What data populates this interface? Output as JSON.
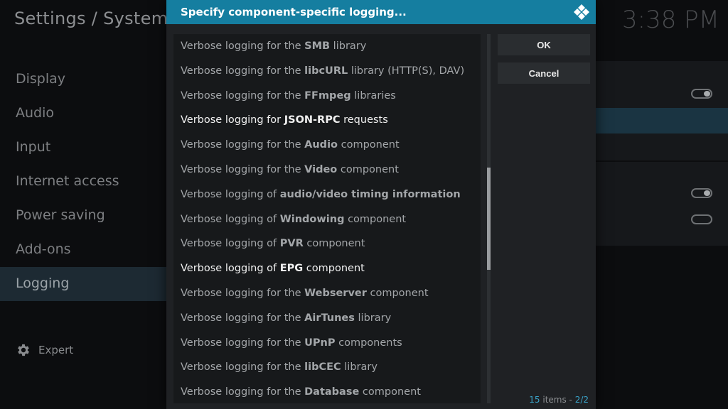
{
  "background": {
    "title": "Settings / System",
    "clock": "3:38 PM",
    "sidebar": [
      {
        "label": "Display"
      },
      {
        "label": "Audio"
      },
      {
        "label": "Input"
      },
      {
        "label": "Internet access"
      },
      {
        "label": "Power saving"
      },
      {
        "label": "Add-ons"
      },
      {
        "label": "Logging",
        "active": true
      }
    ],
    "expert_label": "Expert"
  },
  "dialog": {
    "title": "Specify component-specific logging...",
    "buttons": {
      "ok": "OK",
      "cancel": "Cancel"
    },
    "items": [
      {
        "pre": "Verbose logging for the ",
        "bold": "SMB",
        "post": " library"
      },
      {
        "pre": "Verbose logging for the ",
        "bold": "libcURL",
        "post": " library (HTTP(S), DAV)"
      },
      {
        "pre": "Verbose logging for the ",
        "bold": "FFmpeg",
        "post": " libraries"
      },
      {
        "pre": "Verbose logging for ",
        "bold": "JSON-RPC",
        "post": " requests",
        "selected": true
      },
      {
        "pre": "Verbose logging for the ",
        "bold": "Audio",
        "post": " component"
      },
      {
        "pre": "Verbose logging for the ",
        "bold": "Video",
        "post": " component"
      },
      {
        "pre": "Verbose logging of ",
        "bold": "audio/video timing information",
        "post": ""
      },
      {
        "pre": "Verbose logging of ",
        "bold": "Windowing",
        "post": " component"
      },
      {
        "pre": "Verbose logging of ",
        "bold": "PVR",
        "post": " component"
      },
      {
        "pre": "Verbose logging of ",
        "bold": "EPG",
        "post": " component",
        "selected": true
      },
      {
        "pre": "Verbose logging for the ",
        "bold": "Webserver",
        "post": " component"
      },
      {
        "pre": "Verbose logging for the ",
        "bold": "AirTunes",
        "post": " library"
      },
      {
        "pre": "Verbose logging for the ",
        "bold": "UPnP",
        "post": " components"
      },
      {
        "pre": "Verbose logging for the ",
        "bold": "libCEC",
        "post": " library"
      },
      {
        "pre": "Verbose logging for the ",
        "bold": "Database",
        "post": " component"
      }
    ],
    "footer": {
      "count": "15",
      "label": " items - ",
      "page": "2/2"
    }
  },
  "colors": {
    "header": "#157ea0",
    "accent": "#3aa3c8"
  }
}
